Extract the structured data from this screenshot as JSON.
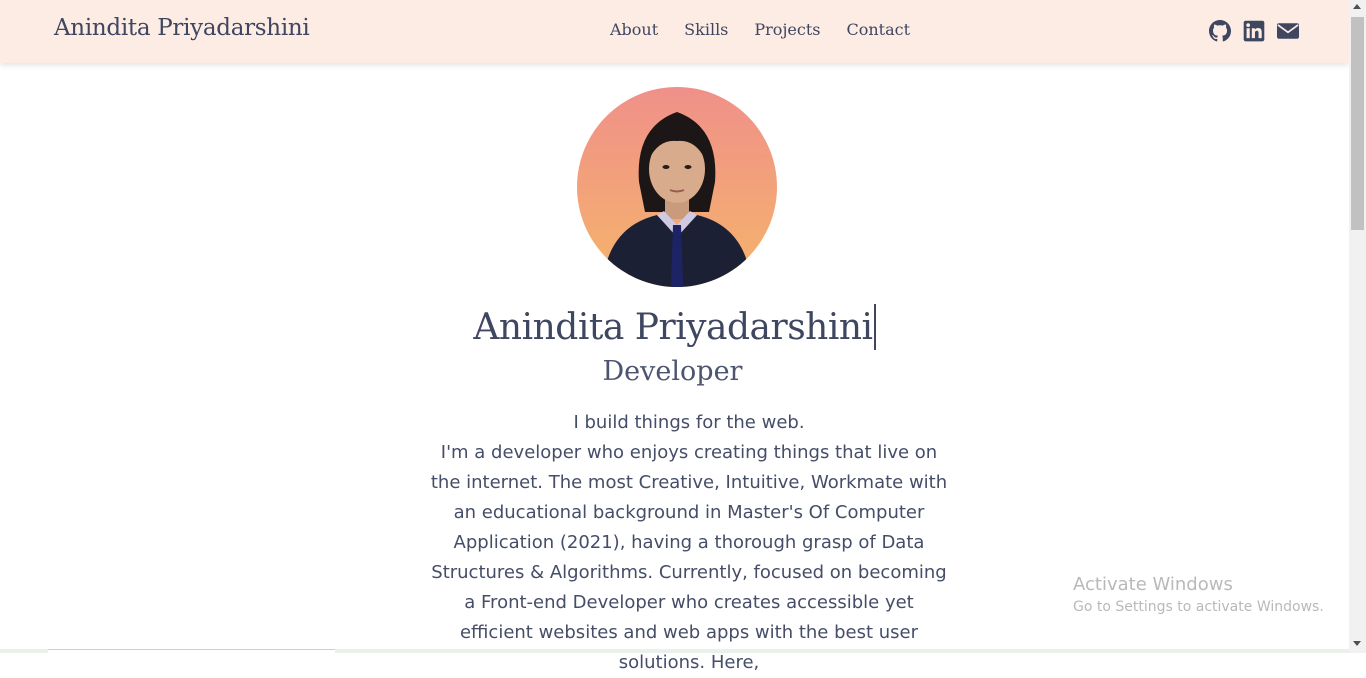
{
  "navbar": {
    "brand": "Anindita Priyadarshini",
    "links": [
      {
        "label": "About"
      },
      {
        "label": "Skills"
      },
      {
        "label": "Projects"
      },
      {
        "label": "Contact"
      }
    ],
    "social_icons": [
      "github-icon",
      "linkedin-icon",
      "envelope-icon"
    ]
  },
  "hero": {
    "name": "Anindita Priyadarshini",
    "role": "Developer",
    "intro_lines": [
      "I build things for the web.",
      "I'm a developer who enjoys creating things that live on the internet. The most Creative, Intuitive, Workmate with an educational background in Master's Of Computer Application (2021), having a thorough grasp of Data Structures & Algorithms. Currently, focused on becoming a Front-end Developer who creates accessible yet efficient websites and web apps with the best user solutions. Here,"
    ]
  },
  "windows_watermark": {
    "title": "Activate Windows",
    "subtitle": "Go to Settings to activate Windows."
  },
  "colors": {
    "navbar_bg": "#fdece4",
    "text_dark": "#3f4660",
    "avatar_gradient_top": "#f0908a",
    "avatar_gradient_bottom": "#f5b46a"
  }
}
